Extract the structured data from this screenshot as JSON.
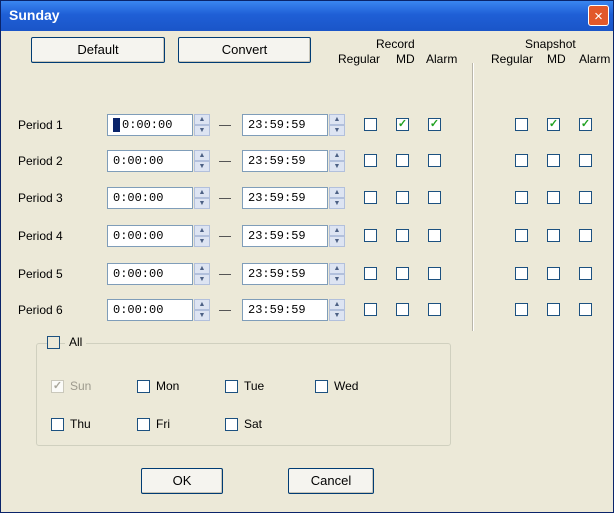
{
  "window": {
    "title": "Sunday",
    "close_glyph": "×"
  },
  "toolbar": {
    "default_label": "Default",
    "convert_label": "Convert"
  },
  "headers": {
    "record": "Record",
    "snapshot": "Snapshot",
    "record_cols": [
      "Regular",
      "MD",
      "Alarm"
    ],
    "snapshot_cols": [
      "Regular",
      "MD",
      "Alarm"
    ]
  },
  "periods": [
    {
      "label": "Period 1",
      "start": "0:00:00",
      "end": "23:59:59",
      "record": [
        false,
        true,
        true
      ],
      "snapshot": [
        false,
        true,
        true
      ]
    },
    {
      "label": "Period 2",
      "start": "0:00:00",
      "end": "23:59:59",
      "record": [
        false,
        false,
        false
      ],
      "snapshot": [
        false,
        false,
        false
      ]
    },
    {
      "label": "Period 3",
      "start": "0:00:00",
      "end": "23:59:59",
      "record": [
        false,
        false,
        false
      ],
      "snapshot": [
        false,
        false,
        false
      ]
    },
    {
      "label": "Period 4",
      "start": "0:00:00",
      "end": "23:59:59",
      "record": [
        false,
        false,
        false
      ],
      "snapshot": [
        false,
        false,
        false
      ]
    },
    {
      "label": "Period 5",
      "start": "0:00:00",
      "end": "23:59:59",
      "record": [
        false,
        false,
        false
      ],
      "snapshot": [
        false,
        false,
        false
      ]
    },
    {
      "label": "Period 6",
      "start": "0:00:00",
      "end": "23:59:59",
      "record": [
        false,
        false,
        false
      ],
      "snapshot": [
        false,
        false,
        false
      ]
    }
  ],
  "days": {
    "all_label": "All",
    "all_checked": false,
    "items": [
      {
        "label": "Sun",
        "checked": true,
        "disabled": true
      },
      {
        "label": "Mon",
        "checked": false,
        "disabled": false
      },
      {
        "label": "Tue",
        "checked": false,
        "disabled": false
      },
      {
        "label": "Wed",
        "checked": false,
        "disabled": false
      },
      {
        "label": "Thu",
        "checked": false,
        "disabled": false
      },
      {
        "label": "Fri",
        "checked": false,
        "disabled": false
      },
      {
        "label": "Sat",
        "checked": false,
        "disabled": false
      }
    ]
  },
  "footer": {
    "ok_label": "OK",
    "cancel_label": "Cancel"
  },
  "check_glyph": "✓",
  "colors": {
    "titlebar": "#1f5fd6",
    "dialog_bg": "#ece9d8",
    "check": "#21a121",
    "close": "#e2582a"
  },
  "icons": {
    "spinner_up": "▲",
    "spinner_down": "▼"
  }
}
